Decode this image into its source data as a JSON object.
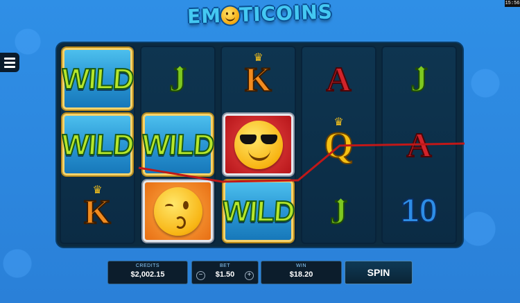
{
  "status_bar": {
    "time": "15:56"
  },
  "logo": {
    "part1": "EM",
    "part2": "TICOINS"
  },
  "reels": [
    [
      {
        "kind": "wild",
        "text": "WILD"
      },
      {
        "kind": "wild",
        "text": "WILD"
      },
      {
        "kind": "letter",
        "text": "K",
        "style": "orange",
        "crown": true
      }
    ],
    [
      {
        "kind": "letter",
        "text": "J",
        "style": "green",
        "shield": true
      },
      {
        "kind": "wild",
        "text": "WILD"
      },
      {
        "kind": "emoji",
        "emoji": "wink-kiss",
        "bg": "orange"
      }
    ],
    [
      {
        "kind": "letter",
        "text": "K",
        "style": "orange",
        "crown": true
      },
      {
        "kind": "emoji",
        "emoji": "sunglasses",
        "bg": "red"
      },
      {
        "kind": "wild",
        "text": "WILD"
      }
    ],
    [
      {
        "kind": "letter",
        "text": "A",
        "style": "red"
      },
      {
        "kind": "letter",
        "text": "Q",
        "style": "gold",
        "crown": true
      },
      {
        "kind": "letter",
        "text": "J",
        "style": "green",
        "shield": true
      }
    ],
    [
      {
        "kind": "letter",
        "text": "J",
        "style": "green",
        "shield": true
      },
      {
        "kind": "letter",
        "text": "A",
        "style": "red"
      },
      {
        "kind": "letter",
        "text": "10",
        "style": "blue"
      }
    ]
  ],
  "controls": {
    "credits_label": "CREDITS",
    "credits_value": "$2,002.15",
    "bet_label": "BET",
    "bet_value": "$1.50",
    "bet_minus": "−",
    "bet_plus": "+",
    "win_label": "WIN",
    "win_value": "$18.20",
    "spin_label": "SPIN"
  },
  "colors": {
    "background": "#2b86de",
    "payline": "#c01818"
  }
}
